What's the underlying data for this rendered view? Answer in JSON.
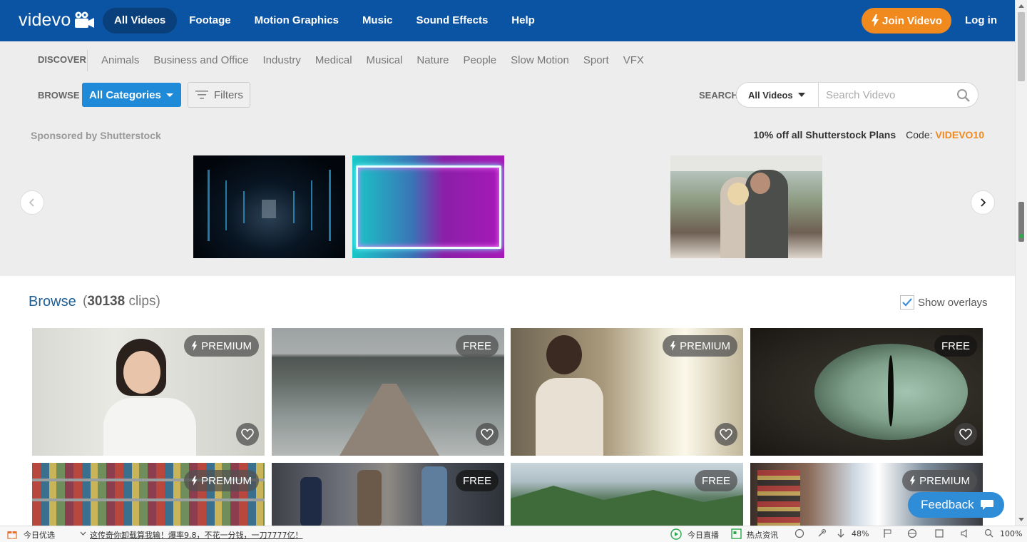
{
  "brand": {
    "logo_text": "videvo"
  },
  "nav": {
    "items": [
      {
        "label": "All Videos",
        "active": true
      },
      {
        "label": "Footage"
      },
      {
        "label": "Motion Graphics"
      },
      {
        "label": "Music"
      },
      {
        "label": "Sound Effects"
      },
      {
        "label": "Help"
      }
    ],
    "join_label": "Join Videvo",
    "login_label": "Log in"
  },
  "discover": {
    "label": "DISCOVER",
    "links": [
      "Animals",
      "Business and Office",
      "Industry",
      "Medical",
      "Musical",
      "Nature",
      "People",
      "Slow Motion",
      "Sport",
      "VFX"
    ]
  },
  "browse_bar": {
    "label": "BROWSE",
    "category": "All Categories",
    "filters_label": "Filters"
  },
  "search": {
    "label": "SEARCH",
    "scope": "All Videos",
    "placeholder": "Search Videvo"
  },
  "sponsored": {
    "label": "Sponsored by Shutterstock",
    "promo_text": "10% off all Shutterstock Plans",
    "code_label": "Code:",
    "code": "VIDEVO10"
  },
  "browse": {
    "title": "Browse",
    "count": "30138",
    "count_suffix": "clips",
    "show_overlays_label": "Show overlays",
    "show_overlays": true
  },
  "clips": [
    {
      "badge": "PREMIUM",
      "premium": true
    },
    {
      "badge": "FREE",
      "premium": false
    },
    {
      "badge": "PREMIUM",
      "premium": true
    },
    {
      "badge": "FREE",
      "premium": false
    },
    {
      "badge": "PREMIUM",
      "premium": true
    },
    {
      "badge": "FREE",
      "premium": false
    },
    {
      "badge": "FREE",
      "premium": false
    },
    {
      "badge": "PREMIUM",
      "premium": true
    }
  ],
  "feedback_label": "Feedback",
  "statusbar": {
    "today_pick": "今日优选",
    "headline": "这传奇你卸载算我输！爆率9.8，不花一分钱，一刀7777亿！",
    "live": "今日直播",
    "hot_news": "热点资讯",
    "download_pct": "48%",
    "zoom": "100%"
  },
  "colors": {
    "nav_bg": "#0b54a3",
    "accent_orange": "#f08a1e",
    "category_blue": "#1f8ad8",
    "feedback_blue": "#2f8cd7"
  }
}
